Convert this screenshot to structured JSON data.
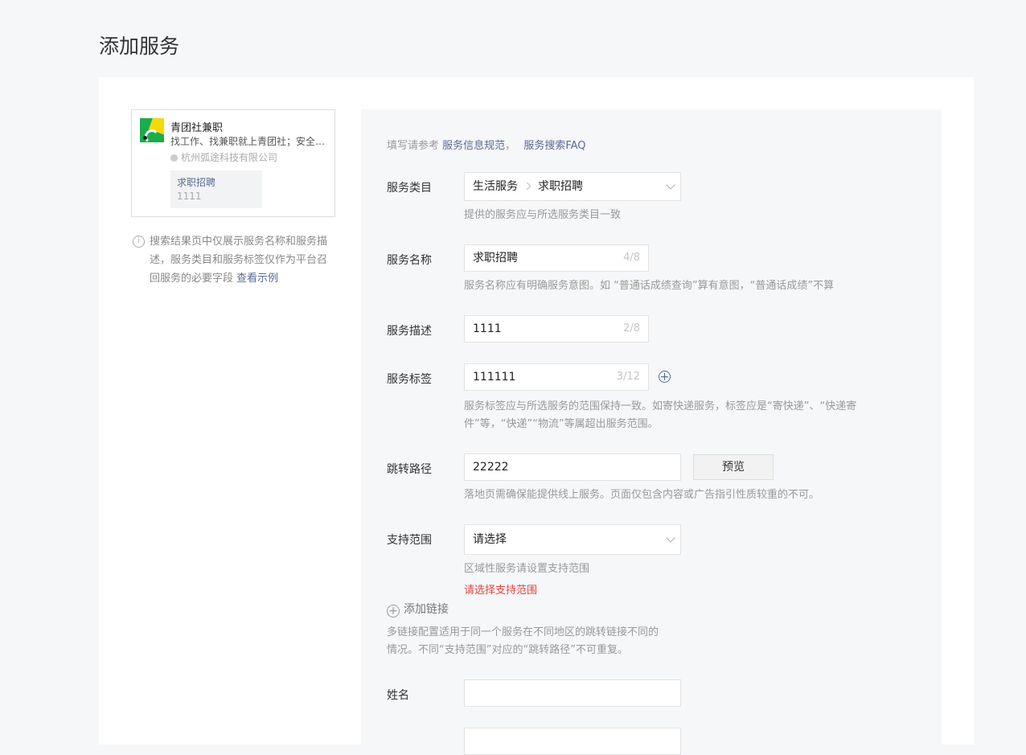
{
  "page": {
    "title": "添加服务"
  },
  "preview": {
    "name": "青团社兼职",
    "description": "找工作、找兼职就上青团社；安全可靠",
    "company": "杭州弧途科技有限公司",
    "tag_label": "求职招聘",
    "tag_value": "1111"
  },
  "tip": {
    "text": "搜索结果页中仅展示服务名称和服务描述，服务类目和服务标签仅作为平台召回服务的必要字段",
    "link": "查看示例"
  },
  "reference": {
    "prefix": "填写请参考",
    "link1": "服务信息规范",
    "comma": "，",
    "link2": "服务搜索FAQ"
  },
  "form": {
    "category": {
      "label": "服务类目",
      "level1": "生活服务",
      "level2": "求职招聘",
      "hint": "提供的服务应与所选服务类目一致"
    },
    "name": {
      "label": "服务名称",
      "value": "求职招聘",
      "counter": "4/8",
      "hint": "服务名称应有明确服务意图。如 “普通话成绩查询”算有意图，“普通话成绩”不算"
    },
    "description": {
      "label": "服务描述",
      "value": "1111",
      "counter": "2/8"
    },
    "tags": {
      "label": "服务标签",
      "value": "111111",
      "counter": "3/12",
      "hint_line1": "服务标签应与所选服务的范围保持一致。如寄快递服务，标签应是“寄快递”、“快递寄",
      "hint_line2": "件”等，“快递”“物流”等属超出服务范围。"
    },
    "path": {
      "label": "跳转路径",
      "value": "22222",
      "preview_button": "预览",
      "hint": "落地页需确保能提供线上服务。页面仅包含内容或广告指引性质较重的不可。"
    },
    "scope": {
      "label": "支持范围",
      "placeholder": "请选择",
      "hint": "区域性服务请设置支持范围",
      "error": "请选择支持范围"
    },
    "add_link": {
      "label": "添加链接",
      "hint_line1": "多链接配置适用于同一个服务在不同地区的跳转链接不同的",
      "hint_line2": "情况。不同“支持范围”对应的“跳转路径”不可重复。"
    },
    "person_name": {
      "label": "姓名",
      "value": ""
    }
  },
  "colors": {
    "link": "#576b95",
    "error": "#e64340",
    "brand_green": "#1aad4d"
  }
}
